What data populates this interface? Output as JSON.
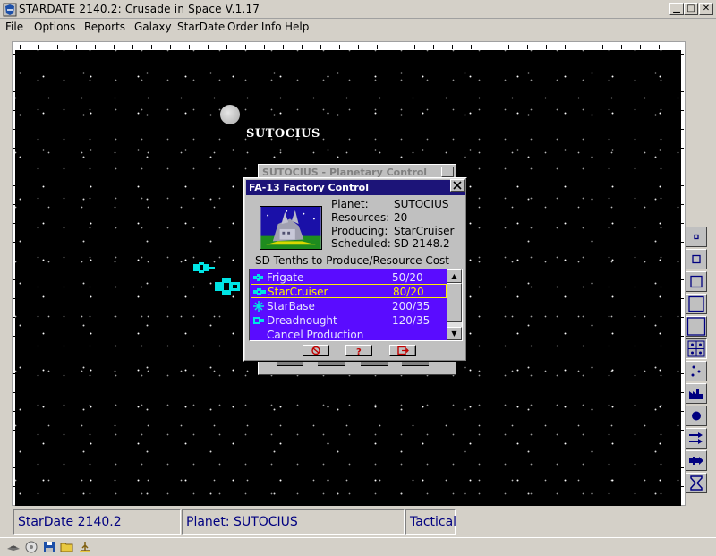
{
  "window": {
    "title": "STARDATE 2140.2: Crusade in Space V.1.17"
  },
  "menu": [
    "File",
    "Options",
    "Reports",
    "Galaxy",
    "StarDate",
    "Order Info",
    "Help"
  ],
  "map": {
    "planet_label": "SUTOCIUS"
  },
  "back_dialog": {
    "title": "SUTOCIUS - Planetary Control"
  },
  "factory_dialog": {
    "title": "FA-13 Factory Control",
    "planet_label": "Planet:",
    "planet_value": "SUTOCIUS",
    "resources_label": "Resources:",
    "resources_value": "20",
    "producing_label": "Producing:",
    "producing_value": "StarCruiser",
    "scheduled_label": "Scheduled:",
    "scheduled_value": "SD 2148.2",
    "list_header": "SD Tenths to Produce/Resource Cost",
    "items": [
      {
        "name": "Frigate",
        "cost": "50/20",
        "icon": "frigate-icon"
      },
      {
        "name": "StarCruiser",
        "cost": "80/20",
        "icon": "starcruiser-icon",
        "selected": true
      },
      {
        "name": "StarBase",
        "cost": "200/35",
        "icon": "starbase-icon"
      },
      {
        "name": "Dreadnought",
        "cost": "120/35",
        "icon": "dreadnought-icon"
      },
      {
        "name": "Cancel Production",
        "cost": "",
        "icon": ""
      }
    ],
    "buttons": [
      "cancel-icon",
      "help-icon",
      "exit-icon"
    ]
  },
  "toolbar_icons": [
    "zoom-1-icon",
    "zoom-2-icon",
    "zoom-3-icon",
    "zoom-4-icon",
    "zoom-5-icon",
    "grid-icon",
    "stars-icon",
    "factory-icon",
    "planet-icon",
    "fleet-move-icon",
    "fleet-attack-icon",
    "hourglass-icon"
  ],
  "status": {
    "stardate": "StarDate 2140.2",
    "planet": "Planet: SUTOCIUS",
    "mode": "Tactical"
  },
  "colors": {
    "space": "#000000",
    "list_bg": "#5a0cff",
    "title_blue": "#1c1478",
    "selected": "#ffee00",
    "ship": "#00e5e5"
  }
}
